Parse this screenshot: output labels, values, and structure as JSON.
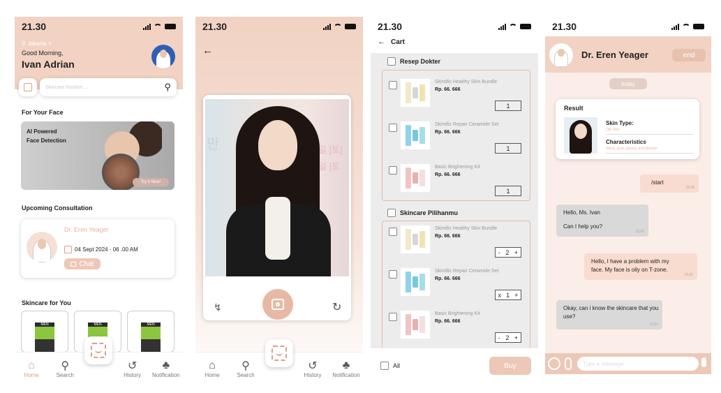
{
  "status_time": "21.30",
  "home": {
    "location": "Jakarta",
    "greeting": "Good Morning,",
    "user_name": "Ivan Adrian",
    "search_placeholder": "Skincare Routine....",
    "for_your_face_title": "For Your Face",
    "banner_text": "AI Powered Face Detection",
    "banner_button": "Try It Now!",
    "upcoming_title": "Upcoming Consultation",
    "doctor_name": "Dr. Eren Yeager",
    "consult_date": "04 Sept 2024 - 06 .00 AM",
    "chat_button": "Chat",
    "skincare_title": "Skincare for You",
    "product_brand": "MEN"
  },
  "nav": {
    "home": "Home",
    "search": "Search",
    "history": "History",
    "notification": "Notification"
  },
  "scan": {
    "back_icon": "arrow-left-icon",
    "poster_text_1": "만",
    "poster_text_2": "일 [토]",
    "poster_text_3": "일 [토"
  },
  "cart": {
    "title": "Cart",
    "section1": "Resep Dokter",
    "section2": "Skincare Pilihanmu",
    "products": [
      {
        "name": "Skintific Healthy Skin Bundle",
        "price": "Rp. 66. 666"
      },
      {
        "name": "Skintific Repair Ceramide Set",
        "price": "Rp. 66. 666"
      },
      {
        "name": "Basic Brightening Kit",
        "price": "Rp. 66. 666"
      }
    ],
    "resep_qty": [
      "1",
      "1",
      "1"
    ],
    "pilihan_qty": [
      {
        "left": "-",
        "qty": "2",
        "right": "+"
      },
      {
        "left": "x",
        "qty": "1",
        "right": "+"
      },
      {
        "left": "-",
        "qty": "2",
        "right": "+"
      }
    ],
    "all_label": "All",
    "buy_button": "Buy"
  },
  "chat": {
    "doctor_name": "Dr. Eren Yeager",
    "end_button": "end",
    "today": "today",
    "result_title": "Result",
    "skin_type_label": "Skin Type:",
    "skin_type_value": "Oily Skin",
    "characteristics_label": "Characteristics",
    "characteristics_value": "Shine, acne, greasy, and blemish",
    "messages": [
      {
        "text": "/start",
        "time": "15.00"
      },
      {
        "text1": "Hello, Ms. Ivan",
        "text2": "Can I help you?",
        "time": "15.00"
      },
      {
        "text": "Hello, I have a problem with my face. My face is oily on T-zone.",
        "time": "15.00"
      },
      {
        "text": "Okay, can i know the skincare that you use?",
        "time": "15.00"
      }
    ],
    "input_placeholder": "Type a message"
  },
  "colors": {
    "accent": "#d9a28a",
    "peach": "#f1d2c3",
    "button": "#edc8b7"
  }
}
